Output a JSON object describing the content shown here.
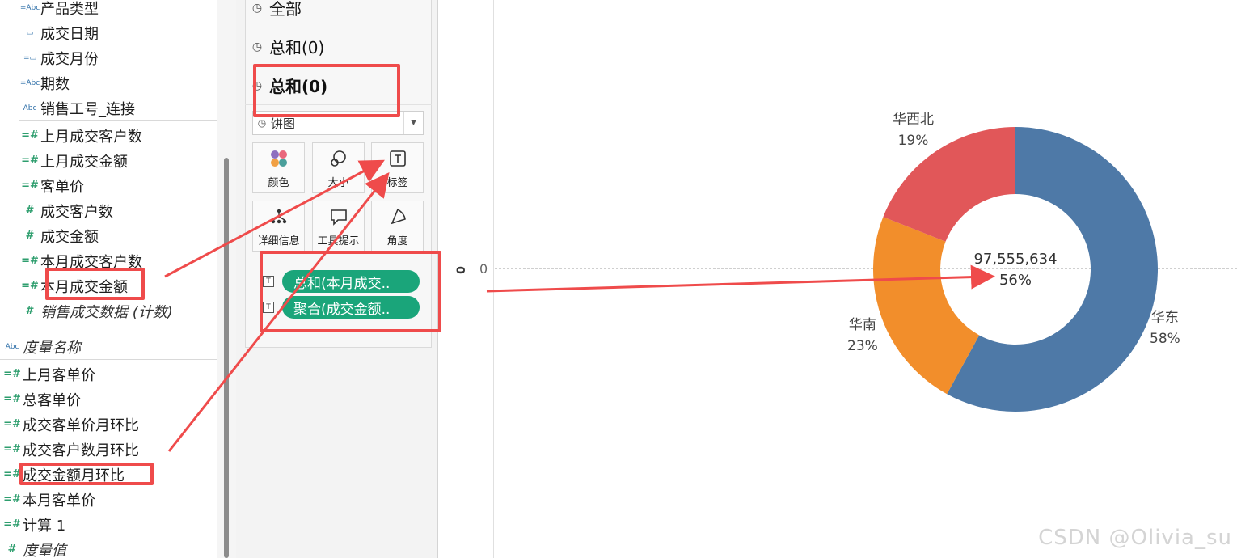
{
  "data_pane": {
    "dimensions": [
      {
        "icon": "=Abc",
        "label": "产品类型"
      },
      {
        "icon": "calendar",
        "label": "成交日期"
      },
      {
        "icon": "calendar-calc",
        "label": "成交月份"
      },
      {
        "icon": "=Abc",
        "label": "期数"
      },
      {
        "icon": "Abc",
        "label": "销售工号_连接"
      }
    ],
    "measures_group": [
      {
        "icon": "=#",
        "label": "上月成交客户数"
      },
      {
        "icon": "=#",
        "label": "上月成交金额"
      },
      {
        "icon": "=#",
        "label": "客单价"
      },
      {
        "icon": "#",
        "label": "成交客户数"
      },
      {
        "icon": "#",
        "label": "成交金额"
      },
      {
        "icon": "=#",
        "label": "本月成交客户数"
      },
      {
        "icon": "=#",
        "label": "本月成交金额"
      },
      {
        "icon": "#",
        "label": "销售成交数据 (计数)"
      }
    ],
    "measure_names": {
      "icon": "Abc",
      "label": "度量名称"
    },
    "measures": [
      {
        "icon": "=#",
        "label": "上月客单价"
      },
      {
        "icon": "=#",
        "label": "总客单价"
      },
      {
        "icon": "=#",
        "label": "成交客单价月环比"
      },
      {
        "icon": "=#",
        "label": "成交客户数月环比"
      },
      {
        "icon": "=#",
        "label": "成交金额月环比"
      },
      {
        "icon": "=#",
        "label": "本月客单价"
      },
      {
        "icon": "=#",
        "label": "计算 1"
      }
    ],
    "measure_values": {
      "icon": "#",
      "label": "度量值"
    }
  },
  "marks_card": {
    "rows": [
      {
        "label": "全部",
        "bold": false
      },
      {
        "label": "总和(0)",
        "bold": false
      },
      {
        "label": "总和(0)",
        "bold": true
      }
    ],
    "mark_type": "饼图",
    "buttons": [
      {
        "icon": "color-dots-icon",
        "label": "颜色"
      },
      {
        "icon": "size-icon",
        "label": "大小"
      },
      {
        "icon": "label-icon",
        "label": "标签"
      },
      {
        "icon": "detail-icon",
        "label": "详细信息"
      },
      {
        "icon": "tooltip-icon",
        "label": "工具提示"
      },
      {
        "icon": "angle-icon",
        "label": "角度"
      }
    ],
    "pills": [
      {
        "type_icon": "T",
        "label": "总和(本月成交.."
      },
      {
        "type_icon": "T",
        "label": "聚合(成交金额.."
      }
    ]
  },
  "view": {
    "axis_title": "0",
    "axis_tick": "0",
    "center_value": "97,555,634",
    "center_percent": "56%",
    "watermark": "CSDN @Olivia_su"
  },
  "chart_data": {
    "type": "pie",
    "donut": true,
    "slices": [
      {
        "name": "华东",
        "percent": 58,
        "label_value": "58%",
        "color": "#4e79a7"
      },
      {
        "name": "华南",
        "percent": 23,
        "label_value": "23%",
        "color": "#f28e2b"
      },
      {
        "name": "华西北",
        "percent": 19,
        "label_value": "19%",
        "color": "#e15759"
      }
    ],
    "center_label": [
      "97,555,634",
      "56%"
    ]
  },
  "annotation_color": "#ef4b4b"
}
